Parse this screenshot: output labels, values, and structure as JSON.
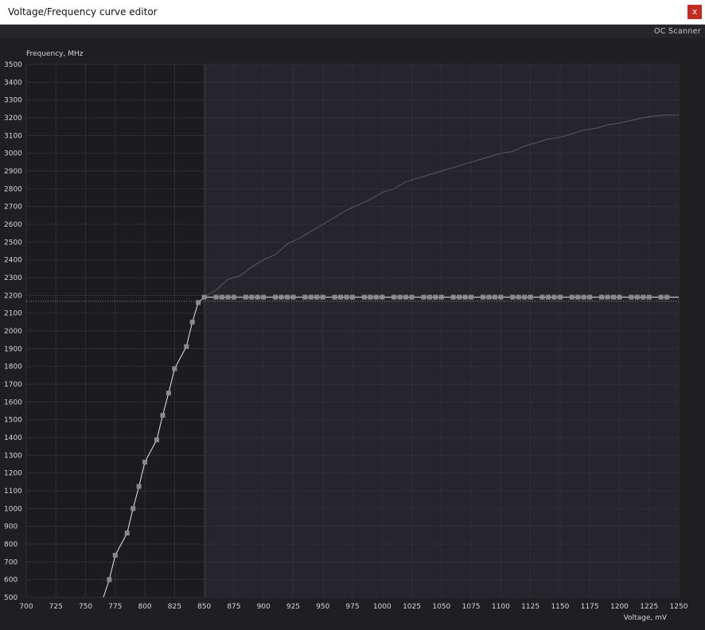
{
  "window": {
    "title": "Voltage/Frequency curve editor",
    "close_label": "x"
  },
  "toolbar": {
    "oc_scanner_label": "OC Scanner"
  },
  "colors": {
    "background": "#1f1f22",
    "plot_left_bg": "#1c1c1f",
    "plot_right_bg": "#25252b",
    "grid": "#2f2f36",
    "curve": "#e6e6e6",
    "curve_point": "#8a8a8a",
    "upper_curve": "#5a5a62"
  },
  "chart_data": {
    "type": "line",
    "title": "",
    "xlabel": "Voltage, mV",
    "ylabel": "Frequency, MHz",
    "xlim": [
      700,
      1250
    ],
    "ylim": [
      500,
      3500
    ],
    "grid": true,
    "x_ticks": [
      700,
      725,
      750,
      775,
      800,
      825,
      850,
      875,
      900,
      925,
      950,
      975,
      1000,
      1025,
      1050,
      1075,
      1100,
      1125,
      1150,
      1175,
      1200,
      1225,
      1250
    ],
    "y_ticks": [
      500,
      600,
      700,
      800,
      900,
      1000,
      1100,
      1200,
      1300,
      1400,
      1500,
      1600,
      1700,
      1800,
      1900,
      2000,
      2100,
      2200,
      2300,
      2400,
      2500,
      2600,
      2700,
      2800,
      2900,
      3000,
      3100,
      3200,
      3300,
      3400,
      3500
    ],
    "selected_voltage": 850,
    "reference_frequency": 2167,
    "vf_curve": {
      "ramp": [
        {
          "x": 765,
          "y": 500
        },
        {
          "x": 770,
          "y": 600
        },
        {
          "x": 775,
          "y": 737
        },
        {
          "x": 785,
          "y": 862
        },
        {
          "x": 790,
          "y": 1000
        },
        {
          "x": 795,
          "y": 1125
        },
        {
          "x": 800,
          "y": 1262
        },
        {
          "x": 810,
          "y": 1387
        },
        {
          "x": 815,
          "y": 1525
        },
        {
          "x": 820,
          "y": 1650
        },
        {
          "x": 825,
          "y": 1787
        },
        {
          "x": 835,
          "y": 1912
        },
        {
          "x": 840,
          "y": 2050
        },
        {
          "x": 845,
          "y": 2160
        }
      ],
      "flat_frequency": 2190,
      "flat_points": [
        850,
        860,
        865,
        870,
        875,
        885,
        890,
        895,
        900,
        910,
        915,
        920,
        925,
        935,
        940,
        945,
        950,
        960,
        965,
        970,
        975,
        985,
        990,
        995,
        1000,
        1010,
        1015,
        1020,
        1025,
        1035,
        1040,
        1045,
        1050,
        1060,
        1065,
        1070,
        1075,
        1085,
        1090,
        1095,
        1100,
        1110,
        1115,
        1120,
        1125,
        1135,
        1140,
        1145,
        1150,
        1160,
        1165,
        1170,
        1175,
        1185,
        1190,
        1195,
        1200,
        1210,
        1215,
        1220,
        1225,
        1235,
        1240
      ],
      "flat_end_x": 1250
    },
    "upper_curve": [
      {
        "x": 850,
        "y": 2190
      },
      {
        "x": 860,
        "y": 2230
      },
      {
        "x": 870,
        "y": 2290
      },
      {
        "x": 880,
        "y": 2310
      },
      {
        "x": 890,
        "y": 2360
      },
      {
        "x": 900,
        "y": 2400
      },
      {
        "x": 910,
        "y": 2430
      },
      {
        "x": 920,
        "y": 2490
      },
      {
        "x": 930,
        "y": 2520
      },
      {
        "x": 940,
        "y": 2560
      },
      {
        "x": 950,
        "y": 2600
      },
      {
        "x": 960,
        "y": 2640
      },
      {
        "x": 970,
        "y": 2680
      },
      {
        "x": 980,
        "y": 2710
      },
      {
        "x": 990,
        "y": 2740
      },
      {
        "x": 1000,
        "y": 2780
      },
      {
        "x": 1010,
        "y": 2800
      },
      {
        "x": 1020,
        "y": 2840
      },
      {
        "x": 1030,
        "y": 2860
      },
      {
        "x": 1040,
        "y": 2880
      },
      {
        "x": 1050,
        "y": 2900
      },
      {
        "x": 1060,
        "y": 2920
      },
      {
        "x": 1070,
        "y": 2940
      },
      {
        "x": 1080,
        "y": 2960
      },
      {
        "x": 1090,
        "y": 2980
      },
      {
        "x": 1100,
        "y": 3000
      },
      {
        "x": 1110,
        "y": 3010
      },
      {
        "x": 1120,
        "y": 3040
      },
      {
        "x": 1130,
        "y": 3060
      },
      {
        "x": 1140,
        "y": 3080
      },
      {
        "x": 1150,
        "y": 3090
      },
      {
        "x": 1160,
        "y": 3110
      },
      {
        "x": 1170,
        "y": 3130
      },
      {
        "x": 1180,
        "y": 3140
      },
      {
        "x": 1190,
        "y": 3160
      },
      {
        "x": 1200,
        "y": 3170
      },
      {
        "x": 1210,
        "y": 3185
      },
      {
        "x": 1220,
        "y": 3200
      },
      {
        "x": 1230,
        "y": 3210
      },
      {
        "x": 1240,
        "y": 3215
      },
      {
        "x": 1250,
        "y": 3215
      }
    ]
  }
}
